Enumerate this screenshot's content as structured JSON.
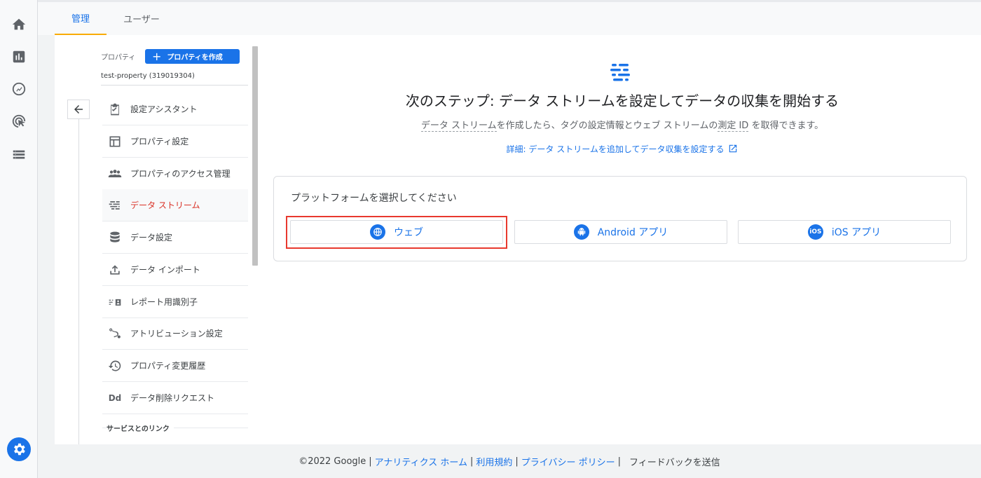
{
  "rail": {
    "icons": [
      "home-icon",
      "reports-icon",
      "explore-icon",
      "advertising-icon",
      "configure-icon"
    ],
    "settings_icon": "gear-icon"
  },
  "tabs": [
    {
      "label": "管理",
      "active": true
    },
    {
      "label": "ユーザー",
      "active": false
    }
  ],
  "property": {
    "label": "プロパティ",
    "create_button": "プロパティを作成",
    "name": "test-property (319019304)"
  },
  "nav": {
    "items": [
      {
        "label": "設定アシスタント",
        "icon": "checklist-icon"
      },
      {
        "label": "プロパティ設定",
        "icon": "layout-icon"
      },
      {
        "label": "プロパティのアクセス管理",
        "icon": "people-icon"
      },
      {
        "label": "データ ストリーム",
        "icon": "streams-icon",
        "active": true
      },
      {
        "label": "データ設定",
        "icon": "database-icon"
      },
      {
        "label": "データ インポート",
        "icon": "upload-icon"
      },
      {
        "label": "レポート用識別子",
        "icon": "identity-icon"
      },
      {
        "label": "アトリビューション設定",
        "icon": "attribution-icon"
      },
      {
        "label": "プロパティ変更履歴",
        "icon": "history-icon"
      },
      {
        "label": "データ削除リクエスト",
        "icon": "Dd"
      }
    ],
    "section_title": "サービスとのリンク"
  },
  "content": {
    "headline": "次のステップ: データ ストリームを設定してデータの収集を開始する",
    "sub_term1": "データ ストリーム",
    "sub_mid": "を作成したら、タグの設定情報とウェブ ストリームの",
    "sub_term2": "測定 ID",
    "sub_end": " を取得できます。",
    "learn_link": "詳細: データ ストリームを追加してデータ収集を設定する",
    "platform_title": "プラットフォームを選択してください",
    "platforms": [
      {
        "label": "ウェブ",
        "icon": "globe-icon",
        "highlighted": true
      },
      {
        "label": "Android アプリ",
        "icon": "android-icon"
      },
      {
        "label": "iOS アプリ",
        "icon": "ios-icon",
        "icon_text": "iOS"
      }
    ]
  },
  "footer": {
    "copyright": "©2022 Google",
    "links": [
      "アナリティクス ホーム",
      "利用規約",
      "プライバシー ポリシー"
    ],
    "feedback": "フィードバックを送信",
    "separator": "|"
  },
  "colors": {
    "accent": "#1a73e8",
    "active_nav": "#d93025",
    "highlight_box": "#e8392e",
    "tab_underline": "#f9ab00"
  }
}
